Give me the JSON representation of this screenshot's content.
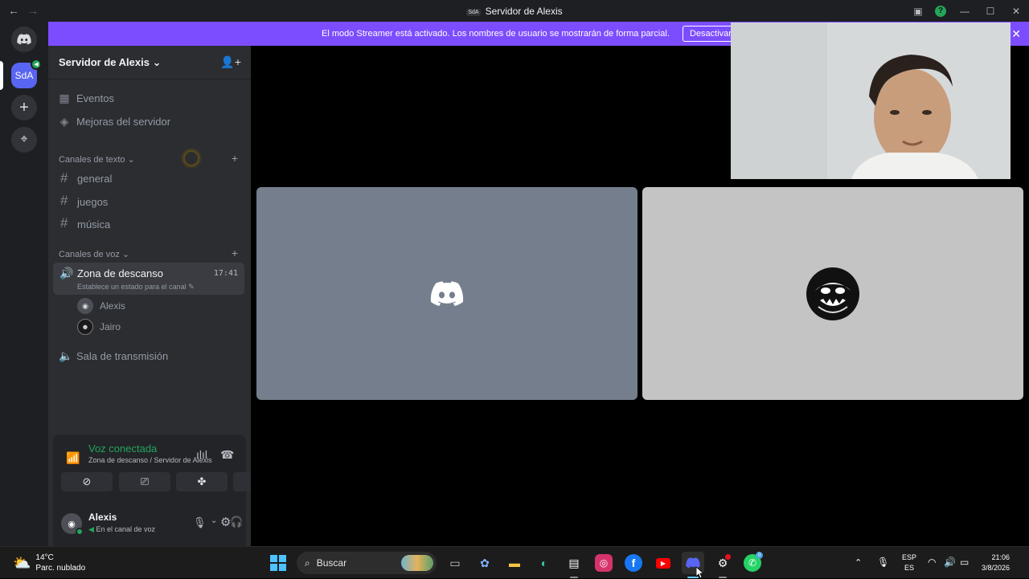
{
  "titlebar": {
    "back": "←",
    "forward": "→",
    "server_tag": "SdA",
    "title": "Servidor de Alexis",
    "inbox_icon": "inbox-icon",
    "help": "?",
    "min": "—",
    "max": "☐",
    "close": "✕"
  },
  "banner": {
    "message": "El modo Streamer está activado. Los nombres de usuario se mostrarán de forma parcial.",
    "button": "Desactivar",
    "close": "✕"
  },
  "guilds": {
    "home_icon": "discord-icon",
    "server_abbr": "SdA",
    "add": "+",
    "explore": "⌖"
  },
  "sidebar": {
    "server_name": "Servidor de Alexis",
    "chevron": "⌄",
    "events": "Eventos",
    "boosts": "Mejoras del servidor",
    "text_category": "Canales de texto",
    "text_channels": [
      "general",
      "juegos",
      "música"
    ],
    "voice_category": "Canales de voz",
    "active_voice": {
      "name": "Zona de descanso",
      "time": "17:41",
      "status": "Establece un estado para el canal"
    },
    "members": [
      "Alexis",
      "Jairo"
    ],
    "other_voice": "Sala de transmisión"
  },
  "voice_panel": {
    "title": "Voz conectada",
    "subtitle": "Zona de descanso / Servidor de Alexis"
  },
  "user": {
    "name": "Alexis",
    "status": "En el canal de voz"
  },
  "taskbar": {
    "temp": "14°C",
    "weather": "Parc. nublado",
    "search": "Buscar",
    "lang1": "ESP",
    "lang2": "ES",
    "time": "21:06",
    "date": "3/8/2026",
    "colors": {
      "discord": "#5865f2",
      "banner": "#7c4dff",
      "green": "#23a55a"
    }
  }
}
